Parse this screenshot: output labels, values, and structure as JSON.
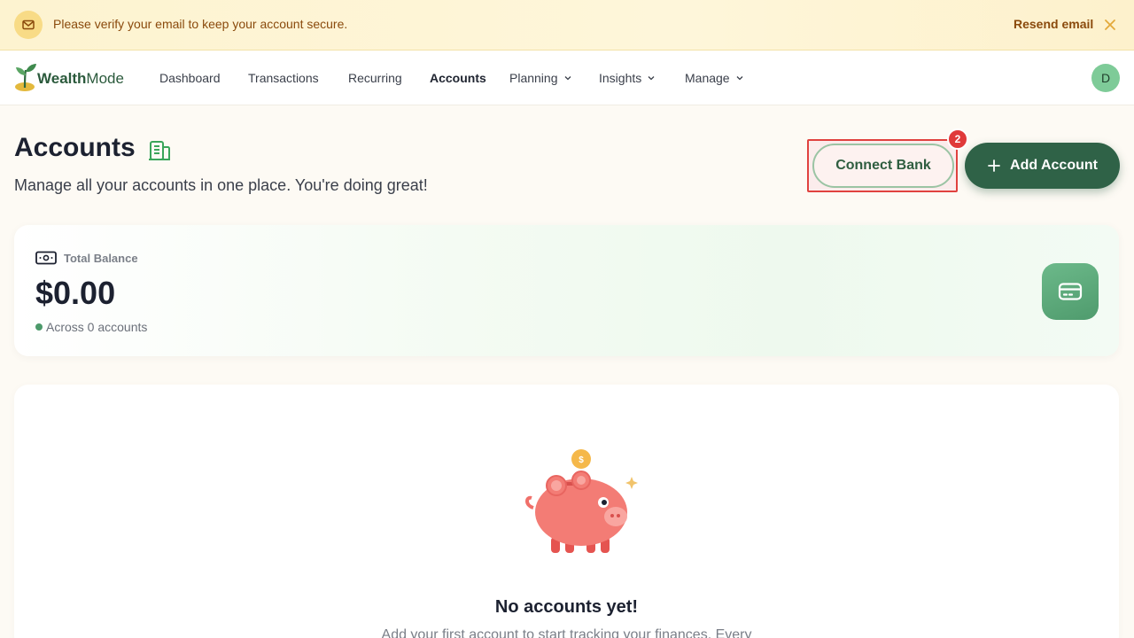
{
  "banner": {
    "message": "Please verify your email to keep your account secure.",
    "action_label": "Resend email",
    "icon": "mail-icon",
    "close_icon": "close-icon"
  },
  "nav": {
    "brand_bold": "Wealth",
    "brand_light": "Mode",
    "items": [
      {
        "label": "Dashboard",
        "dropdown": false
      },
      {
        "label": "Transactions",
        "dropdown": false
      },
      {
        "label": "Recurring",
        "dropdown": false
      },
      {
        "label": "Accounts",
        "dropdown": false,
        "active": true
      },
      {
        "label": "Planning",
        "dropdown": true
      },
      {
        "label": "Insights",
        "dropdown": true
      },
      {
        "label": "Manage",
        "dropdown": true
      }
    ],
    "avatar_initial": "D"
  },
  "header": {
    "title": "Accounts",
    "subtitle": "Manage all your accounts in one place. You're doing great!",
    "connect_label": "Connect Bank",
    "connect_badge": "2",
    "add_label": "Add Account",
    "title_icon": "building-icon"
  },
  "balance": {
    "label": "Total Balance",
    "amount": "$0.00",
    "sub": "Across 0 accounts",
    "icon": "banknote-icon",
    "card_icon": "credit-card-icon"
  },
  "empty": {
    "title": "No accounts yet!",
    "description": "Add your first account to start tracking your finances. Every",
    "illustration": "piggy-bank-icon"
  },
  "colors": {
    "accent": "#2f6247",
    "banner_text": "#8a4a0c",
    "highlight": "#e0423f"
  }
}
